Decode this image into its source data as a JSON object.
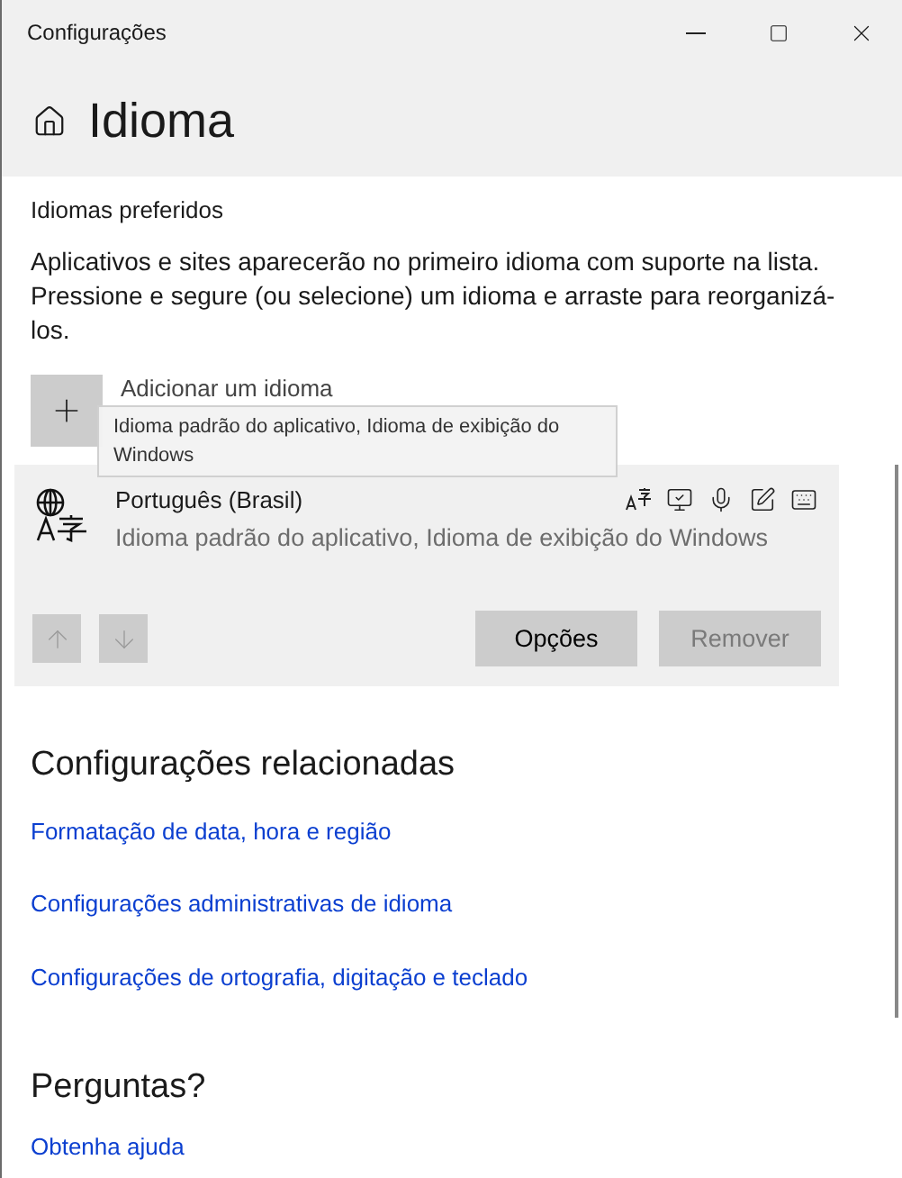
{
  "window": {
    "title": "Configurações"
  },
  "page": {
    "title": "Idioma"
  },
  "preferred": {
    "heading": "Idiomas preferidos",
    "description": "Aplicativos e sites aparecerão no primeiro idioma com suporte na lista. Pressione e segure (ou selecione) um idioma e arraste para reorganizá-los.",
    "add_button": "Adicionar um idioma",
    "tooltip": "Idioma padrão do aplicativo, Idioma de exibição do Windows"
  },
  "languages": [
    {
      "name": "Português (Brasil)",
      "detail": "Idioma padrão do aplicativo, Idioma de exibição do Windows",
      "selected": true,
      "move_up_disabled": true,
      "move_down_disabled": true,
      "buttons": [
        {
          "label": "Opções",
          "disabled": false
        },
        {
          "label": "Remover",
          "disabled": true
        }
      ]
    }
  ],
  "related": {
    "heading": "Configurações relacionadas",
    "links": [
      "Formatação de data, hora e região",
      "Configurações administrativas de idioma",
      "Configurações de ortografia, digitação e teclado"
    ]
  },
  "questions": {
    "heading": "Perguntas?",
    "links": [
      "Obtenha ajuda"
    ]
  }
}
